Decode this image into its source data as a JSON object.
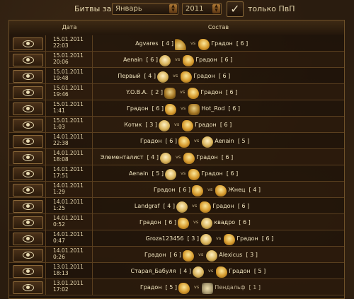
{
  "filter": {
    "label": "Битвы за:",
    "month": "Январь",
    "year": "2011",
    "checkbox_mark": "✓",
    "pvp_label": "только ПвП"
  },
  "table": {
    "headers": {
      "date": "Дата",
      "composition": "Состав"
    },
    "vs": "vs",
    "rows": [
      {
        "date": "15.01.2011",
        "time": "22:03",
        "p1": "Agvares",
        "l1": "[ 4 ]",
        "f1": "hat",
        "p2": "Градон",
        "l2": "[ 6 ]",
        "f2": "bird"
      },
      {
        "date": "15.01.2011",
        "time": "20:06",
        "p1": "Aenain",
        "l1": "[ 6 ]",
        "f1": "skull",
        "p2": "Градон",
        "l2": "[ 6 ]",
        "f2": "bird"
      },
      {
        "date": "15.01.2011",
        "time": "19:48",
        "p1": "Первый",
        "l1": "[ 4 ]",
        "f1": "skull",
        "p2": "Градон",
        "l2": "[ 6 ]",
        "f2": "bird"
      },
      {
        "date": "15.01.2011",
        "time": "19:46",
        "p1": "Y.O.B.A.",
        "l1": "[ 2 ]",
        "f1": "dragon",
        "p2": "Градон",
        "l2": "[ 6 ]",
        "f2": "bird"
      },
      {
        "date": "15.01.2011",
        "time": "1:41",
        "p1": "Градон",
        "l1": "[ 6 ]",
        "f1": "bird",
        "p2": "Hot_Rod",
        "l2": "[ 6 ]",
        "f2": "dragon"
      },
      {
        "date": "15.01.2011",
        "time": "1:03",
        "p1": "Котик",
        "l1": "[ 3 ]",
        "f1": "skull",
        "p2": "Градон",
        "l2": "[ 6 ]",
        "f2": "bird"
      },
      {
        "date": "14.01.2011",
        "time": "22:38",
        "p1": "Градон",
        "l1": "[ 6 ]",
        "f1": "bird",
        "p2": "Aenain",
        "l2": "[ 5 ]",
        "f2": "skull"
      },
      {
        "date": "14.01.2011",
        "time": "18:08",
        "p1": "Элементалист",
        "l1": "[ 4 ]",
        "f1": "skull",
        "p2": "Градон",
        "l2": "[ 6 ]",
        "f2": "bird"
      },
      {
        "date": "14.01.2011",
        "time": "17:51",
        "p1": "Aenain",
        "l1": "[ 5 ]",
        "f1": "skull",
        "p2": "Градон",
        "l2": "[ 6 ]",
        "f2": "bird"
      },
      {
        "date": "14.01.2011",
        "time": "1:29",
        "p1": "Градон",
        "l1": "[ 6 ]",
        "f1": "bird",
        "p2": "Жнец",
        "l2": "[ 4 ]",
        "f2": "bird"
      },
      {
        "date": "14.01.2011",
        "time": "1:25",
        "p1": "Landgraf",
        "l1": "[ 4 ]",
        "f1": "skull",
        "p2": "Градон",
        "l2": "[ 6 ]",
        "f2": "bird"
      },
      {
        "date": "14.01.2011",
        "time": "0:52",
        "p1": "Градон",
        "l1": "[ 6 ]",
        "f1": "bird",
        "p2": "квадро",
        "l2": "[ 6 ]",
        "f2": "skull"
      },
      {
        "date": "14.01.2011",
        "time": "0:47",
        "p1": "Groza123456",
        "l1": "[ 3 ]",
        "f1": "skull",
        "p2": "Градон",
        "l2": "[ 6 ]",
        "f2": "bird"
      },
      {
        "date": "14.01.2011",
        "time": "0:26",
        "p1": "Градон",
        "l1": "[ 6 ]",
        "f1": "bird",
        "p2": "Alexicus",
        "l2": "[ 3 ]",
        "f2": "skull"
      },
      {
        "date": "13.01.2011",
        "time": "18:13",
        "p1": "Старая_Бабуля",
        "l1": "[ 4 ]",
        "f1": "skull",
        "p2": "Градон",
        "l2": "[ 5 ]",
        "f2": "bird"
      },
      {
        "date": "13.01.2011",
        "time": "17:02",
        "p1": "Градон",
        "l1": "[ 5 ]",
        "f1": "bird",
        "p2": "Пендальф",
        "l2": "[ 1 ]",
        "f2": "cross"
      }
    ]
  },
  "colors": {
    "accent": "#e8d9b0",
    "border": "#6e5129",
    "background": "#2a1c0f"
  }
}
